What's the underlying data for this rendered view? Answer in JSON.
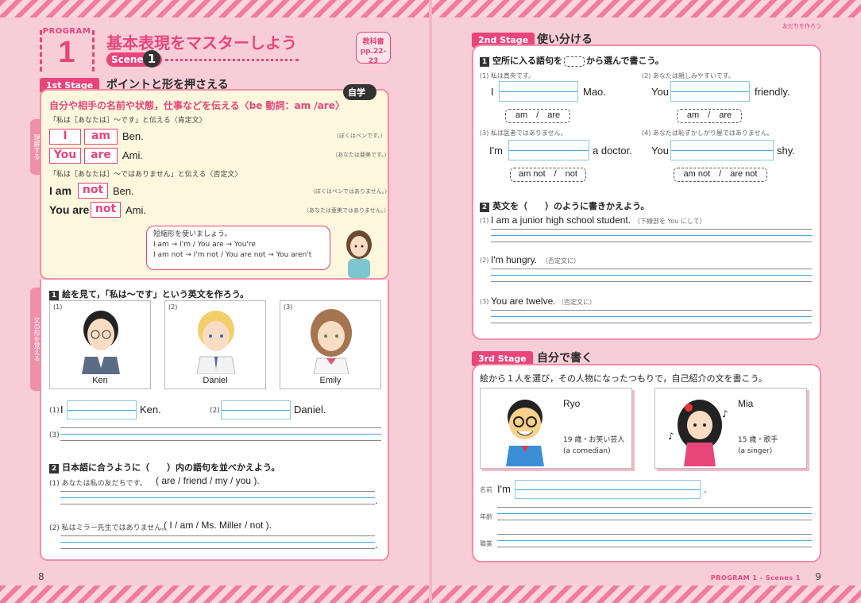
{
  "header": {
    "program_label": "PROGRAM",
    "program_number": "1",
    "title": "基本表現をマスターしよう",
    "scenes_label": "Scenes",
    "scenes_number": "1",
    "textbook_ref_line1": "教科書",
    "textbook_ref_line2": "pp.22-23",
    "corner_text": "友だちを作ろう"
  },
  "stage1": {
    "tag": "1st Stage",
    "heading": "ポイントと形を押さえる",
    "jigaku": "自学",
    "side_tab_top": "理解する",
    "side_tab_bottom": "文の形を覚える",
    "rule": "自分や相手の名前や状態，仕事などを伝える〈be 動詞：am /are〉",
    "affirm_note": "「私は［あなたは］～です」と伝える〈肯定文〉",
    "affirm": [
      {
        "subj": "I",
        "verb": "am",
        "rest": "Ben.",
        "jp": "（ぼくはベンです。）"
      },
      {
        "subj": "You",
        "verb": "are",
        "rest": "Ami.",
        "jp": "（あなたは亜美です。）"
      }
    ],
    "neg_note": "「私は［あなたは］～ではありません」と伝える〈否定文〉",
    "neg": [
      {
        "subj": "I am",
        "not": "not",
        "rest": "Ben.",
        "jp": "（ぼくはベンではありません。）"
      },
      {
        "subj": "You are",
        "not": "not",
        "rest": "Ami.",
        "jp": "（あなたは亜美ではありません。）"
      }
    ],
    "bubble": [
      "短縮形を使いましょう。",
      "I am → I'm / You are → You're",
      "I am not → I'm not / You are not → You aren't"
    ]
  },
  "exercise1": {
    "num": "1",
    "instruction": "絵を見て，「私は～です」という英文を作ろう。",
    "cards": [
      {
        "idx": "(1)",
        "name": "Ken"
      },
      {
        "idx": "(2)",
        "name": "Daniel"
      },
      {
        "idx": "(3)",
        "name": "Emily"
      }
    ],
    "q1_idx": "(1)",
    "q1_pre": "I",
    "q1_post": "Ken.",
    "q2_idx": "(2)",
    "q2_post": "Daniel.",
    "q3_idx": "(3)"
  },
  "exercise2": {
    "num": "2",
    "instruction": "日本語に合うように（　　）内の語句を並べかえよう。",
    "items": [
      {
        "idx": "(1)",
        "jp": "あなたは私の友だちです。",
        "words": "( are / friend / my / you )."
      },
      {
        "idx": "(2)",
        "jp": "私はミラー先生ではありません。",
        "words": "( I / am / Ms. Miller / not )."
      }
    ]
  },
  "stage2": {
    "tag": "2nd Stage",
    "heading": "使い分ける",
    "q1_num": "1",
    "q1_pre": "空所に入る語句を",
    "q1_post": "から選んで書こう。",
    "items": [
      {
        "idx": "(1)",
        "jp": "私は真央です。",
        "pre": "I",
        "post": "Mao.",
        "choices": "am　/　are"
      },
      {
        "idx": "(2)",
        "jp": "あなたは親しみやすいです。",
        "pre": "You",
        "post": "friendly.",
        "choices": "am　/　are"
      },
      {
        "idx": "(3)",
        "jp": "私は医者ではありません。",
        "pre": "I'm",
        "post": "a doctor.",
        "choices": "am not　/　not"
      },
      {
        "idx": "(4)",
        "jp": "あなたは恥ずかしがり屋ではありません。",
        "pre": "You",
        "post": "shy.",
        "choices": "am not　/　are not"
      }
    ],
    "q2_num": "2",
    "q2_instruction": "英文を（　　）のように書きかえよう。",
    "rewrite": [
      {
        "idx": "(1)",
        "text": "I am a junior high school student.",
        "note": "（下線部を You にして）"
      },
      {
        "idx": "(2)",
        "text": "I'm hungry.",
        "note": "（否定文に）"
      },
      {
        "idx": "(3)",
        "text": "You are twelve.",
        "note": "（否定文に）"
      }
    ]
  },
  "stage3": {
    "tag": "3rd Stage",
    "heading": "自分で書く",
    "instruction": "絵から１人を選び，その人物になったつもりで，自己紹介の文を書こう。",
    "chars": [
      {
        "name": "Ryo",
        "desc1": "19 歳・お笑い芸人",
        "desc2": "(a comedian)"
      },
      {
        "name": "Mia",
        "desc1": "15 歳・歌手",
        "desc2": "(a singer)"
      }
    ],
    "name_label": "名前",
    "name_pre": "I'm",
    "age_label": "年齢",
    "job_label": "職業"
  },
  "footer": {
    "left_page": "8",
    "right_page": "9",
    "program": "PROGRAM 1 - Scenes 1"
  },
  "colors": {
    "accent": "#e8457b",
    "background": "#f7cdd8",
    "answer_line": "#42a9d8"
  }
}
